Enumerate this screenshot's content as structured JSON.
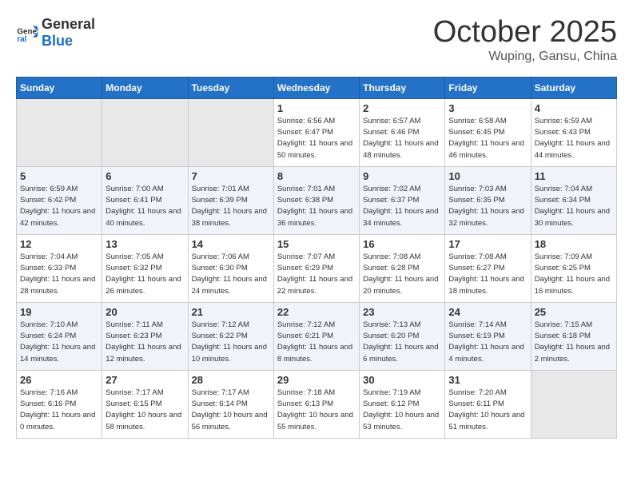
{
  "header": {
    "logo_general": "General",
    "logo_blue": "Blue",
    "month": "October 2025",
    "location": "Wuping, Gansu, China"
  },
  "days_of_week": [
    "Sunday",
    "Monday",
    "Tuesday",
    "Wednesday",
    "Thursday",
    "Friday",
    "Saturday"
  ],
  "weeks": [
    [
      {
        "day": "",
        "info": ""
      },
      {
        "day": "",
        "info": ""
      },
      {
        "day": "",
        "info": ""
      },
      {
        "day": "1",
        "info": "Sunrise: 6:56 AM\nSunset: 6:47 PM\nDaylight: 11 hours and 50 minutes."
      },
      {
        "day": "2",
        "info": "Sunrise: 6:57 AM\nSunset: 6:46 PM\nDaylight: 11 hours and 48 minutes."
      },
      {
        "day": "3",
        "info": "Sunrise: 6:58 AM\nSunset: 6:45 PM\nDaylight: 11 hours and 46 minutes."
      },
      {
        "day": "4",
        "info": "Sunrise: 6:59 AM\nSunset: 6:43 PM\nDaylight: 11 hours and 44 minutes."
      }
    ],
    [
      {
        "day": "5",
        "info": "Sunrise: 6:59 AM\nSunset: 6:42 PM\nDaylight: 11 hours and 42 minutes."
      },
      {
        "day": "6",
        "info": "Sunrise: 7:00 AM\nSunset: 6:41 PM\nDaylight: 11 hours and 40 minutes."
      },
      {
        "day": "7",
        "info": "Sunrise: 7:01 AM\nSunset: 6:39 PM\nDaylight: 11 hours and 38 minutes."
      },
      {
        "day": "8",
        "info": "Sunrise: 7:01 AM\nSunset: 6:38 PM\nDaylight: 11 hours and 36 minutes."
      },
      {
        "day": "9",
        "info": "Sunrise: 7:02 AM\nSunset: 6:37 PM\nDaylight: 11 hours and 34 minutes."
      },
      {
        "day": "10",
        "info": "Sunrise: 7:03 AM\nSunset: 6:35 PM\nDaylight: 11 hours and 32 minutes."
      },
      {
        "day": "11",
        "info": "Sunrise: 7:04 AM\nSunset: 6:34 PM\nDaylight: 11 hours and 30 minutes."
      }
    ],
    [
      {
        "day": "12",
        "info": "Sunrise: 7:04 AM\nSunset: 6:33 PM\nDaylight: 11 hours and 28 minutes."
      },
      {
        "day": "13",
        "info": "Sunrise: 7:05 AM\nSunset: 6:32 PM\nDaylight: 11 hours and 26 minutes."
      },
      {
        "day": "14",
        "info": "Sunrise: 7:06 AM\nSunset: 6:30 PM\nDaylight: 11 hours and 24 minutes."
      },
      {
        "day": "15",
        "info": "Sunrise: 7:07 AM\nSunset: 6:29 PM\nDaylight: 11 hours and 22 minutes."
      },
      {
        "day": "16",
        "info": "Sunrise: 7:08 AM\nSunset: 6:28 PM\nDaylight: 11 hours and 20 minutes."
      },
      {
        "day": "17",
        "info": "Sunrise: 7:08 AM\nSunset: 6:27 PM\nDaylight: 11 hours and 18 minutes."
      },
      {
        "day": "18",
        "info": "Sunrise: 7:09 AM\nSunset: 6:25 PM\nDaylight: 11 hours and 16 minutes."
      }
    ],
    [
      {
        "day": "19",
        "info": "Sunrise: 7:10 AM\nSunset: 6:24 PM\nDaylight: 11 hours and 14 minutes."
      },
      {
        "day": "20",
        "info": "Sunrise: 7:11 AM\nSunset: 6:23 PM\nDaylight: 11 hours and 12 minutes."
      },
      {
        "day": "21",
        "info": "Sunrise: 7:12 AM\nSunset: 6:22 PM\nDaylight: 11 hours and 10 minutes."
      },
      {
        "day": "22",
        "info": "Sunrise: 7:12 AM\nSunset: 6:21 PM\nDaylight: 11 hours and 8 minutes."
      },
      {
        "day": "23",
        "info": "Sunrise: 7:13 AM\nSunset: 6:20 PM\nDaylight: 11 hours and 6 minutes."
      },
      {
        "day": "24",
        "info": "Sunrise: 7:14 AM\nSunset: 6:19 PM\nDaylight: 11 hours and 4 minutes."
      },
      {
        "day": "25",
        "info": "Sunrise: 7:15 AM\nSunset: 6:18 PM\nDaylight: 11 hours and 2 minutes."
      }
    ],
    [
      {
        "day": "26",
        "info": "Sunrise: 7:16 AM\nSunset: 6:16 PM\nDaylight: 11 hours and 0 minutes."
      },
      {
        "day": "27",
        "info": "Sunrise: 7:17 AM\nSunset: 6:15 PM\nDaylight: 10 hours and 58 minutes."
      },
      {
        "day": "28",
        "info": "Sunrise: 7:17 AM\nSunset: 6:14 PM\nDaylight: 10 hours and 56 minutes."
      },
      {
        "day": "29",
        "info": "Sunrise: 7:18 AM\nSunset: 6:13 PM\nDaylight: 10 hours and 55 minutes."
      },
      {
        "day": "30",
        "info": "Sunrise: 7:19 AM\nSunset: 6:12 PM\nDaylight: 10 hours and 53 minutes."
      },
      {
        "day": "31",
        "info": "Sunrise: 7:20 AM\nSunset: 6:11 PM\nDaylight: 10 hours and 51 minutes."
      },
      {
        "day": "",
        "info": ""
      }
    ]
  ]
}
